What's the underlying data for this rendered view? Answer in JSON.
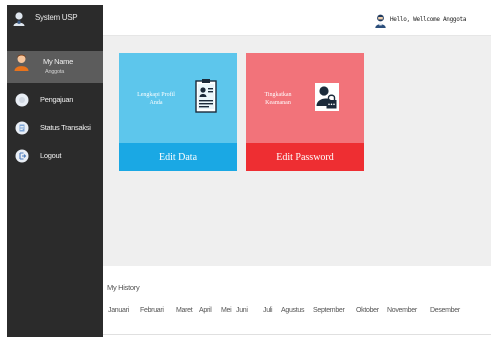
{
  "app": {
    "title": "System USP"
  },
  "profile": {
    "name": "My Name",
    "role": "Anggota"
  },
  "nav": {
    "items": [
      {
        "label": "Pengajuan",
        "icon": "circle-icon"
      },
      {
        "label": "Status Transaksi",
        "icon": "document-icon"
      },
      {
        "label": "Logout",
        "icon": "logout-icon"
      }
    ]
  },
  "header": {
    "greeting": "Hello, Wellcome Anggota",
    "icon": "user-icon"
  },
  "cards": {
    "profile": {
      "caption_line1": "Lengkapi Profil",
      "caption_line2": "Anda",
      "button": "Edit Data",
      "icon": "id-card-icon"
    },
    "password": {
      "caption_line1": "Tingkatkan",
      "caption_line2": "Keamanan",
      "button": "Edit Password",
      "icon": "user-lock-icon"
    }
  },
  "history": {
    "title": "My History",
    "months": [
      "Januari",
      "Februari",
      "Maret",
      "April",
      "Mei",
      "Juni",
      "Juli",
      "Agustus",
      "September",
      "Oktober",
      "November",
      "Desember"
    ]
  },
  "colors": {
    "sidebar": "#2b2b2b",
    "profile_active": "#5c5c5c",
    "card_blue_top": "#5dc6ec",
    "card_blue_bottom": "#1aa8e4",
    "card_red_top": "#f2737a",
    "card_red_bottom": "#ee2e32"
  }
}
